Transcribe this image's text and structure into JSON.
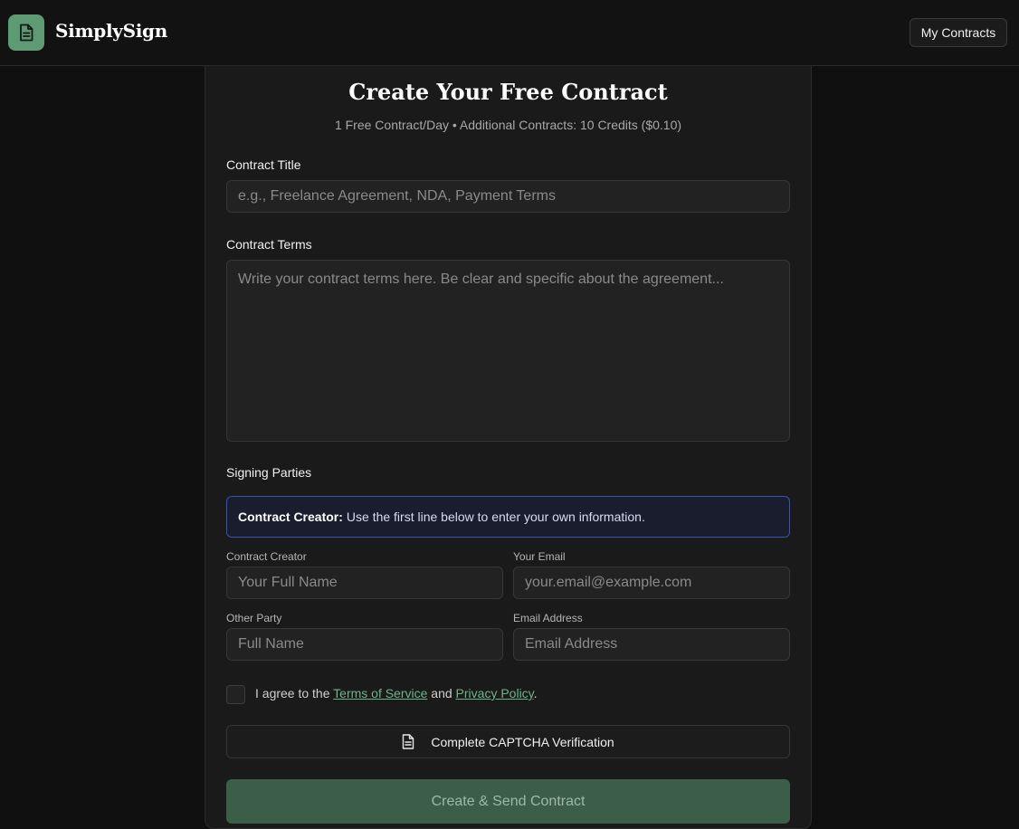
{
  "header": {
    "brand": "SimplySign",
    "logo_icon": "document-icon",
    "my_contracts_label": "My Contracts"
  },
  "form": {
    "title": "Create Your Free Contract",
    "subtitle": "1 Free Contract/Day • Additional Contracts: 10 Credits ($0.10)",
    "contract_title": {
      "label": "Contract Title",
      "value": "",
      "placeholder": "e.g., Freelance Agreement, NDA, Payment Terms"
    },
    "contract_terms": {
      "label": "Contract Terms",
      "value": "",
      "placeholder": "Write your contract terms here. Be clear and specific about the agreement..."
    },
    "signing_parties_label": "Signing Parties",
    "info_box": {
      "bold": "Contract Creator:",
      "text": "Use the first line below to enter your own information."
    },
    "creator_name": {
      "label": "Contract Creator",
      "value": "",
      "placeholder": "Your Full Name"
    },
    "creator_email": {
      "label": "Your Email",
      "value": "",
      "placeholder": "your.email@example.com"
    },
    "other_name": {
      "label": "Other Party",
      "value": "",
      "placeholder": "Full Name"
    },
    "other_email": {
      "label": "Email Address",
      "value": "",
      "placeholder": "Email Address"
    },
    "agree": {
      "prefix": "I agree to the",
      "terms_link": "Terms of Service",
      "middle": "and",
      "privacy_link": "Privacy Policy",
      "suffix": ".",
      "checked": false
    },
    "captcha_label": "Complete CAPTCHA Verification",
    "captcha_icon": "document-icon",
    "submit_label": "Create & Send Contract"
  },
  "colors": {
    "accent": "#5e9a73",
    "submit_bg": "#3c5e49",
    "info_border": "#3b50b8",
    "link": "#6db38a"
  }
}
